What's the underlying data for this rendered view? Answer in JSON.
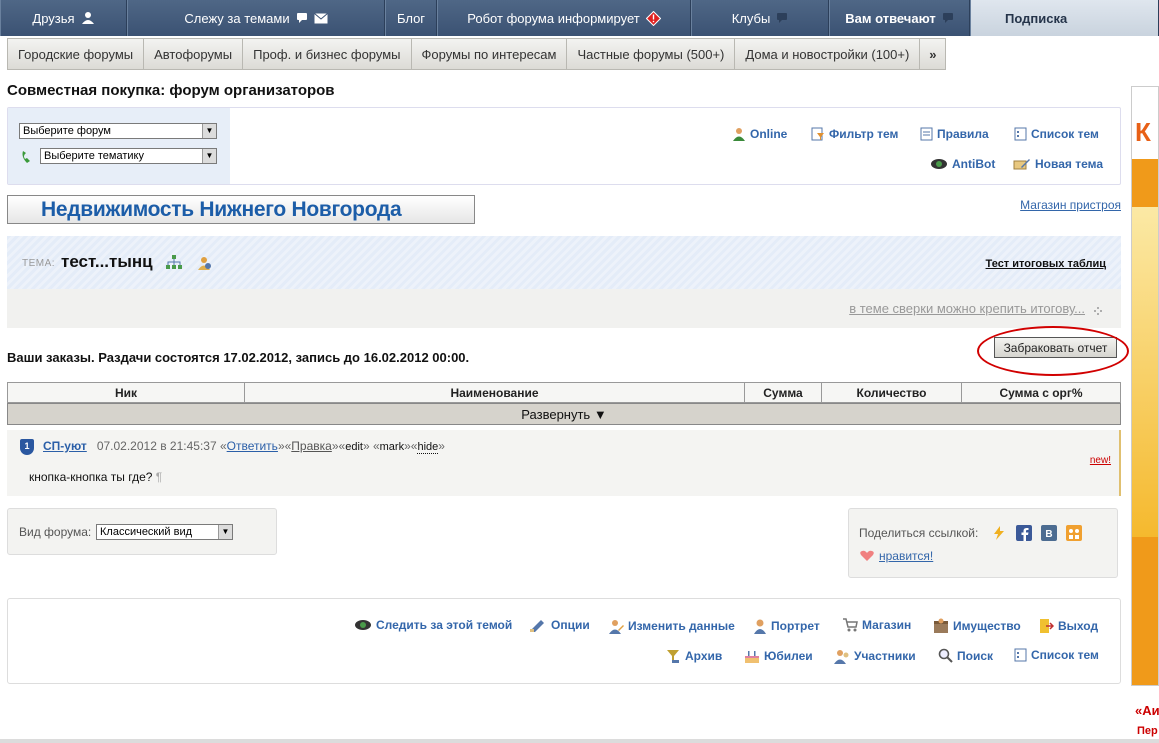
{
  "topnav": {
    "items": [
      {
        "label": "Друзья"
      },
      {
        "label": "Слежу за темами"
      },
      {
        "label": "Блог"
      },
      {
        "label": "Робот форума информирует"
      },
      {
        "label": "Клубы"
      },
      {
        "label": "Вам отвечают"
      },
      {
        "label": "Подписка"
      }
    ]
  },
  "subnav": {
    "tabs": [
      "Городские форумы",
      "Автофорумы",
      "Проф. и бизнес форумы",
      "Форумы по интересам",
      "Частные форумы (500+)",
      "Дома и новостройки (100+)"
    ],
    "more": "»"
  },
  "page_title": "Совместная покупка: форум организаторов",
  "selectors": {
    "forum": "Выберите форум",
    "theme": "Выберите тематику"
  },
  "toplinks": {
    "online": "Online",
    "filter": "Фильтр тем",
    "rules": "Правила",
    "list": "Список тем",
    "antibot": "AntiBot",
    "new_topic": "Новая тема"
  },
  "banner": "Недвижимость Нижнего Новгорода",
  "shop_link": "Магазин пристроя",
  "topic": {
    "label": "ТЕМА:",
    "name": "тест...тынц",
    "tests": "Тест итоговых таблиц",
    "note": "в теме сверки можно крепить итогову..."
  },
  "orders": {
    "text": "Ваши заказы. Раздачи состоятся 17.02.2012, запись до 16.02.2012 00:00.",
    "reject_button": "Забраковать отчет"
  },
  "table": {
    "headers": [
      "Ник",
      "Наименование",
      "Сумма",
      "Количество",
      "Сумма с орг%"
    ],
    "expand": "Развернуть ▼"
  },
  "post": {
    "rank": "1",
    "user": "СП-уют",
    "date": "07.02.2012 в 21:45:37",
    "reply": "Ответить",
    "edit_label": "Правка",
    "edit": "edit",
    "mark": "mark",
    "hide": "hide",
    "new": "new!",
    "text": "кнопка-кнопка ты где?",
    "pilcrow": "¶"
  },
  "view": {
    "label": "Вид форума:",
    "value": "Классический вид"
  },
  "share": {
    "label": "Поделиться ссылкой:",
    "like": "нравится!"
  },
  "bottom_links": {
    "watch": "Следить за этой темой",
    "options": "Опции",
    "change": "Изменить данные",
    "portrait": "Портрет",
    "shop": "Магазин",
    "property": "Имущество",
    "logout": "Выход",
    "archive": "Архив",
    "jubilee": "Юбилеи",
    "members": "Участники",
    "search": "Поиск",
    "topic_list": "Список тем"
  },
  "ad": {
    "letter": "К",
    "bottom1": "«Аи",
    "bottom2": "Пер"
  },
  "colors": {
    "nav_dark": "#3b5273",
    "link_blue": "#3366aa",
    "banner_blue": "#1c5da8",
    "red_mark": "#d10000"
  }
}
